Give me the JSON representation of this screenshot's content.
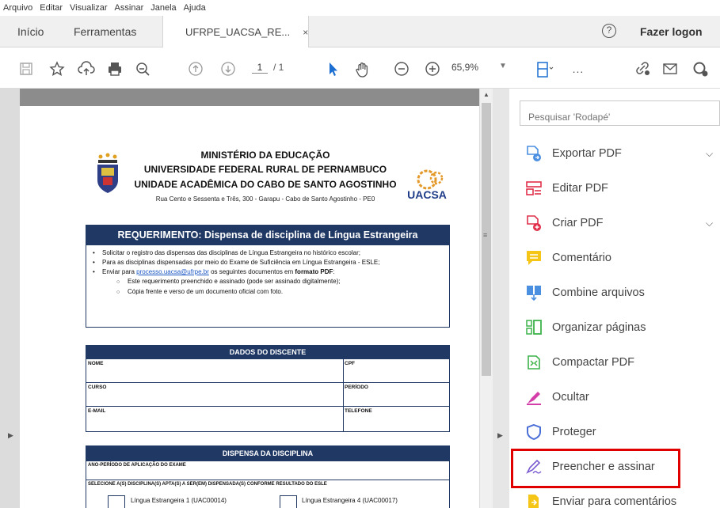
{
  "menubar": {
    "items": [
      "Arquivo",
      "Editar",
      "Visualizar",
      "Assinar",
      "Janela",
      "Ajuda"
    ]
  },
  "tabs": {
    "home": "Início",
    "tools": "Ferramentas",
    "document": "UFRPE_UACSA_RE...",
    "close": "×"
  },
  "header": {
    "help": "?",
    "login": "Fazer logon"
  },
  "toolbar": {
    "page_current": "1",
    "page_total": "/ 1",
    "zoom": "65,9%",
    "more": "..."
  },
  "document": {
    "header_line1": "MINISTÉRIO DA EDUCAÇÃO",
    "header_line2": "UNIVERSIDADE FEDERAL RURAL DE PERNAMBUCO",
    "header_line3": "UNIDADE ACADÊMICA DO CABO DE SANTO AGOSTINHO",
    "address": "Rua Cento e Sessenta e Três, 300 - Garapu - Cabo de Santo Agostinho - PE0",
    "logo_text": "UACSA",
    "requerimento": {
      "title": "REQUERIMENTO: Dispensa de disciplina de Língua Estrangeira",
      "bullet1": "Solicitar o registro das dispensas das disciplinas de Língua Estrangeira no histórico escolar;",
      "bullet2": "Para as disciplinas dispensadas por meio do Exame de Suficiência em Língua Estrangeira  - ESLE;",
      "bullet3_pre": "Enviar para ",
      "bullet3_link": "processo.uacsa@ufrpe.br",
      "bullet3_mid": " os seguintes documentos em ",
      "bullet3_bold": "formato PDF",
      "bullet3_end": ":",
      "sub1": "Este requerimento preenchido e assinado (pode ser assinado digitalmente);",
      "sub2": "Cópia frente e verso de um documento oficial com foto."
    },
    "dados": {
      "title": "DADOS DO DISCENTE",
      "nome": "NOME",
      "cpf": "CPF",
      "curso": "CURSO",
      "periodo": "PERÍODO",
      "email": "E-MAIL",
      "telefone": "TELEFONE"
    },
    "dispensa": {
      "title": "DISPENSA DA DISCIPLINA",
      "row1": "ANO-PERÍODO DE APLICAÇÃO DO EXAME",
      "row2": "SELECIONE A(S) DISCIPLINA(S) APTA(S) A SER(EM) DISPENSADA(S) CONFORME RESULTADO DO ESLE",
      "opt1": "Língua Estrangeira 1 (UAC00014)",
      "opt2": "Língua Estrangeira 4 (UAC00017)"
    }
  },
  "right_panel": {
    "search_placeholder": "Pesquisar 'Rodapé'",
    "tools": [
      {
        "label": "Exportar PDF",
        "icon": "export-pdf-icon",
        "color": "#4b8fe0"
      },
      {
        "label": "Editar PDF",
        "icon": "edit-pdf-icon",
        "color": "#e0304a"
      },
      {
        "label": "Criar PDF",
        "icon": "create-pdf-icon",
        "color": "#e0304a"
      },
      {
        "label": "Comentário",
        "icon": "comment-icon",
        "color": "#f5c518"
      },
      {
        "label": "Combine arquivos",
        "icon": "combine-files-icon",
        "color": "#4b8fe0"
      },
      {
        "label": "Organizar páginas",
        "icon": "organize-pages-icon",
        "color": "#3db34a"
      },
      {
        "label": "Compactar PDF",
        "icon": "compress-pdf-icon",
        "color": "#3db34a"
      },
      {
        "label": "Ocultar",
        "icon": "redact-icon",
        "color": "#d33ea8"
      },
      {
        "label": "Proteger",
        "icon": "protect-icon",
        "color": "#4b6fd8"
      },
      {
        "label": "Preencher e assinar",
        "icon": "fill-sign-icon",
        "color": "#7a5bd1"
      },
      {
        "label": "Enviar para comentários",
        "icon": "send-comments-icon",
        "color": "#f5c518"
      }
    ]
  },
  "colors": {
    "form_blue": "#1f3864",
    "highlight_red": "#e00000"
  }
}
